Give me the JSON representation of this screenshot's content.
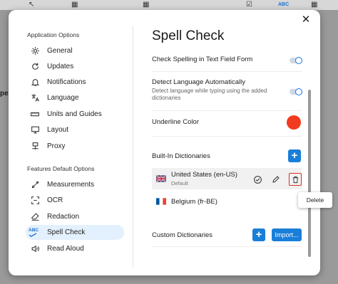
{
  "background": {
    "toolbar_icons": [
      "cursor-icon",
      "grid-icon",
      "grid-icon",
      "check-icon",
      "abc-icon",
      "grid-icon"
    ],
    "abc_label": "ABC",
    "edge_text": "pe"
  },
  "sidebar": {
    "section1_title": "Application Options",
    "app_items": [
      {
        "label": "General",
        "icon": "gear-icon"
      },
      {
        "label": "Updates",
        "icon": "refresh-icon"
      },
      {
        "label": "Notifications",
        "icon": "bell-icon"
      },
      {
        "label": "Language",
        "icon": "language-icon"
      },
      {
        "label": "Units and Guides",
        "icon": "ruler-icon"
      },
      {
        "label": "Layout",
        "icon": "monitor-icon"
      },
      {
        "label": "Proxy",
        "icon": "network-icon"
      }
    ],
    "section2_title": "Features Default Options",
    "feature_items": [
      {
        "label": "Measurements",
        "icon": "measure-icon"
      },
      {
        "label": "OCR",
        "icon": "ocr-icon"
      },
      {
        "label": "Redaction",
        "icon": "eraser-icon"
      },
      {
        "label": "Spell Check",
        "icon": "spellcheck-icon",
        "active": true
      },
      {
        "label": "Read Aloud",
        "icon": "speaker-icon"
      }
    ],
    "abc_badge": "ABC"
  },
  "main": {
    "title": "Spell Check",
    "check_text_field": {
      "label": "Check Spelling in Text Field Form",
      "enabled": true
    },
    "detect_language": {
      "label": "Detect Language Automatically",
      "description": "Detect language while typing using the added dictionaries",
      "enabled": true
    },
    "underline_color": {
      "label": "Underline Color",
      "color": "#f23a1f"
    },
    "builtin": {
      "title": "Built-In Dictionaries",
      "add_symbol": "+",
      "dictionaries": [
        {
          "name": "United States (en-US)",
          "sub": "Default",
          "flag": "us-flag-icon"
        },
        {
          "name": "Belgium (fr-BE)",
          "sub": "",
          "flag": "fr-flag-icon"
        }
      ]
    },
    "custom": {
      "title": "Custom Dictionaries",
      "add_symbol": "+",
      "import_label": "Import..."
    }
  },
  "tooltip": {
    "text": "Delete"
  },
  "colors": {
    "accent": "#1a7fd9",
    "active_bg": "#e3f0fd",
    "delete_border": "#d93025"
  }
}
